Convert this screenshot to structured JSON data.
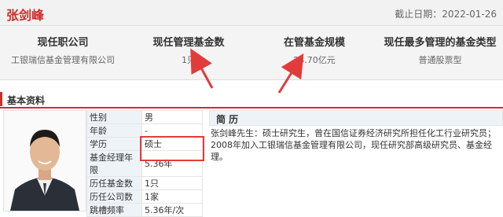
{
  "header": {
    "name": "张剑峰",
    "date": "截止日期：2022-01-26"
  },
  "stats": [
    {
      "label": "现任职公司",
      "value": "工银瑞信基金管理有限公司"
    },
    {
      "label": "现任管理基金数",
      "value": "1只"
    },
    {
      "label": "在管基金规模",
      "value": "23.70亿元"
    },
    {
      "label": "现任最多管理的基金类型",
      "value": "普通股票型"
    }
  ],
  "section": {
    "title": "基本资料"
  },
  "info": [
    {
      "key": "性别",
      "value": "男"
    },
    {
      "key": "年龄",
      "value": "-"
    },
    {
      "key": "学历",
      "value": "硕士"
    },
    {
      "key": "基金经理年限",
      "value": "5.36年"
    },
    {
      "key": "历任基金数",
      "value": "1只"
    },
    {
      "key": "历任公司数",
      "value": "1家"
    },
    {
      "key": "跳槽频率",
      "value": "5.36年/次"
    }
  ],
  "resume": {
    "title": "简 历",
    "text": "张剑峰先生：硕士研究生，曾在国信证券经济研究所担任化工行业研究员；2008年加入工银瑞信基金管理有限公司，现任研究部高级研究员、基金经理。"
  },
  "colors": {
    "accent": "#c9302c",
    "highlight": "#e23b3b"
  }
}
